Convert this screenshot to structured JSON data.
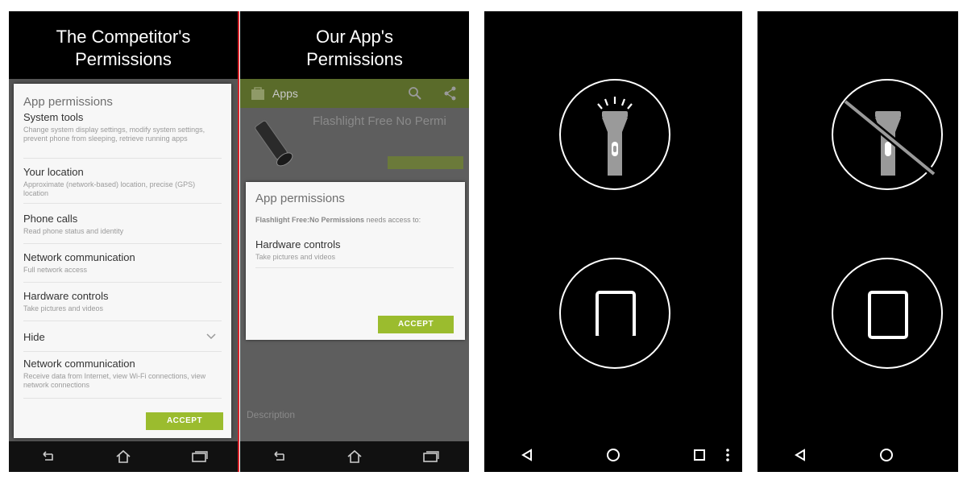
{
  "competitor": {
    "heading_line1": "The Competitor's",
    "heading_line2": "Permissions",
    "dialog_title": "App permissions",
    "permissions": [
      {
        "title": "System tools",
        "desc": "Change system display settings, modify system settings, prevent phone from sleeping, retrieve running apps"
      },
      {
        "title": "Your location",
        "desc": "Approximate (network-based) location, precise (GPS) location"
      },
      {
        "title": "Phone calls",
        "desc": "Read phone status and identity"
      },
      {
        "title": "Network communication",
        "desc": "Full network access"
      },
      {
        "title": "Hardware controls",
        "desc": "Take pictures and videos"
      }
    ],
    "hide_label": "Hide",
    "extra_permission": {
      "title": "Network communication",
      "desc": "Receive data from Internet, view Wi-Fi connections, view network connections"
    },
    "accept_label": "ACCEPT"
  },
  "ours": {
    "heading_line1": "Our App's",
    "heading_line2": "Permissions",
    "appbar_label": "Apps",
    "app_name": "Flashlight Free No Permi",
    "dialog_title": "App permissions",
    "needs_access_app": "Flashlight Free:No Permissions",
    "needs_access_text": " needs access to:",
    "permission": {
      "title": "Hardware controls",
      "desc": "Take pictures and videos"
    },
    "accept_label": "ACCEPT",
    "description_label": "Description"
  },
  "colors": {
    "accent": "#9bbc2e",
    "divider": "#d8232a"
  },
  "icons": [
    "flashlight-on-icon",
    "flashlight-off-icon",
    "phone-screen-icon",
    "back-icon",
    "home-icon",
    "recents-icon",
    "overflow-menu-icon"
  ]
}
